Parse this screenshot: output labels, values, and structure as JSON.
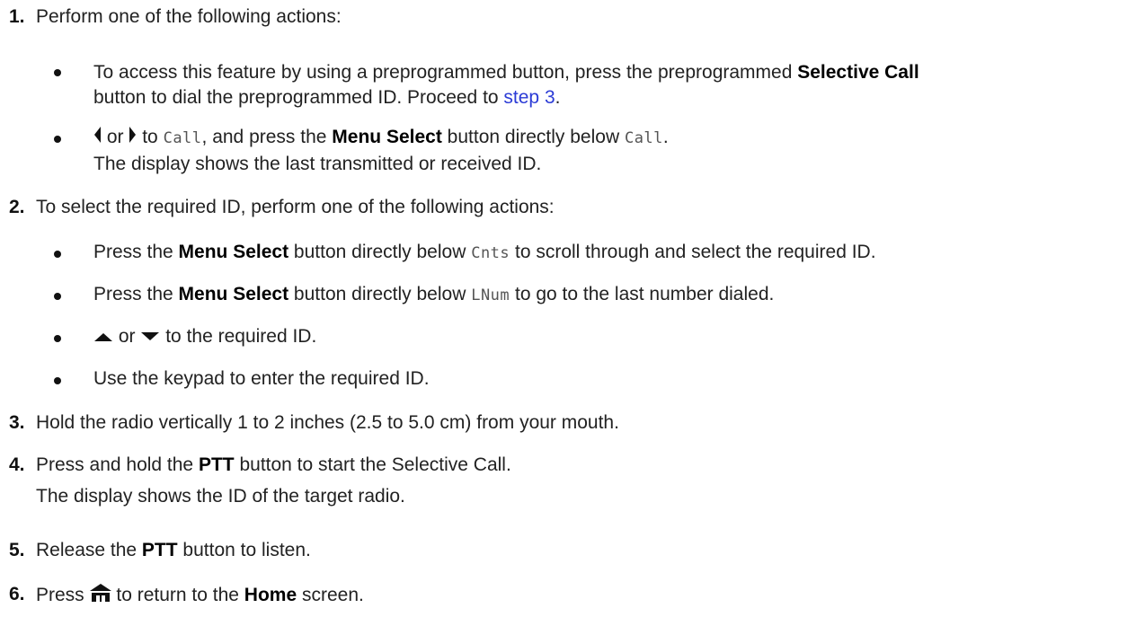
{
  "steps": {
    "s1": {
      "num": "1.",
      "text": "Perform one of the following actions:",
      "b1": {
        "pre": "To access this feature by using a preprogrammed button, press the preprogrammed ",
        "bold": "Selective Call",
        "line2_pre": "button to dial the preprogrammed ID. Proceed to ",
        "link": "step 3",
        "line2_post": "."
      },
      "b2": {
        "or": "or",
        "to": "to",
        "code1": "Call",
        "mid": ", and press the ",
        "bold": "Menu Select",
        "post": " button directly below ",
        "code2": "Call",
        "end": ".",
        "line2": "The display shows the last transmitted or received ID."
      }
    },
    "s2": {
      "num": "2.",
      "text": "To select the required ID, perform one of the following actions:",
      "b1": {
        "pre": "Press the ",
        "bold": "Menu Select",
        "mid": " button directly below ",
        "code": "Cnts",
        "post": " to scroll through and select the required ID."
      },
      "b2": {
        "pre": "Press the ",
        "bold": "Menu Select",
        "mid": " button directly below ",
        "code": "LNum",
        "post": " to go to the last number dialed."
      },
      "b3": {
        "or": "or",
        "post": "to the required ID."
      },
      "b4": {
        "text": "Use the keypad to enter the required ID."
      }
    },
    "s3": {
      "num": "3.",
      "text": "Hold the radio vertically 1 to 2 inches (2.5 to 5.0 cm) from your mouth."
    },
    "s4": {
      "num": "4.",
      "pre": "Press and hold the ",
      "bold": "PTT",
      "post": " button to start the Selective Call.",
      "line2": "The display shows the ID of the target radio."
    },
    "s5": {
      "num": "5.",
      "pre": "Release the ",
      "bold": "PTT",
      "post": " button to listen."
    },
    "s6": {
      "num": "6.",
      "pre": "Press",
      "mid": "to return to the ",
      "bold": "Home",
      "post": " screen."
    }
  },
  "icons": {
    "left": "left-arrow-icon",
    "right": "right-arrow-icon",
    "up": "up-arrow-icon",
    "down": "down-arrow-icon",
    "home": "home-icon"
  },
  "colors": {
    "link": "#2b3bd6",
    "text": "#222222",
    "code": "#555555"
  }
}
